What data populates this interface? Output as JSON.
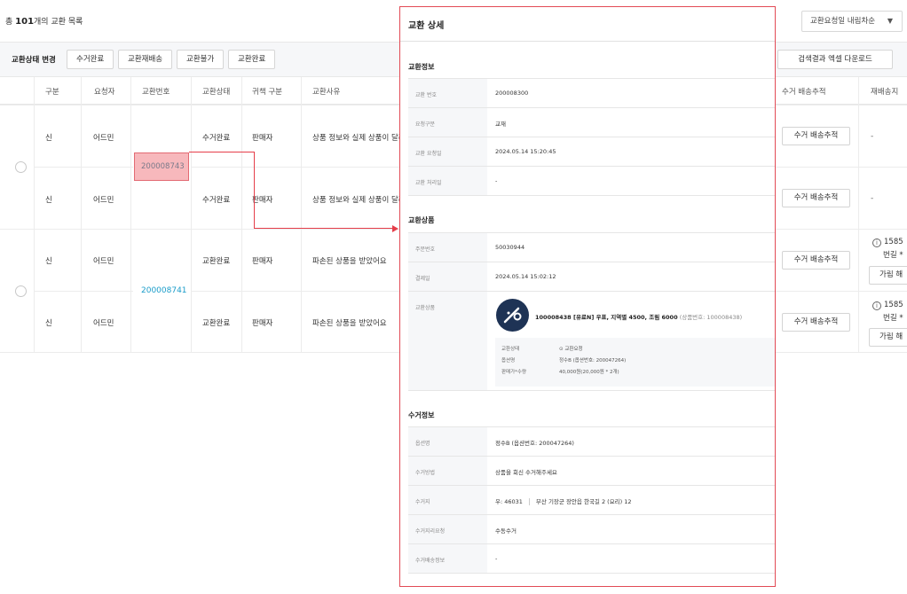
{
  "list": {
    "total_prefix": "총 ",
    "total_count": "101",
    "total_suffix": "개의 교환 목록",
    "sort_label": "교환요청일 내림차순",
    "toolbar": {
      "label": "교환상태 변경",
      "buttons": [
        "수거완료",
        "교환재배송",
        "교환불가",
        "교환완료"
      ],
      "excel_label": "검색결과 엑셀 다운로드"
    },
    "headers": [
      "구분",
      "요청자",
      "교환번호",
      "교환상태",
      "귀책 구분",
      "교환사유",
      "수거 배송추적",
      "재배송지"
    ],
    "rows": [
      {
        "type": "신",
        "requester": "어드민",
        "status": "수거완료",
        "fault": "판매자",
        "reason": "상품 정보와 실제 상품이 달라"
      },
      {
        "type": "신",
        "requester": "어드민",
        "status": "수거완료",
        "fault": "판매자",
        "reason": "상품 정보와 실제 상품이 달라"
      },
      {
        "type": "신",
        "requester": "어드민",
        "status": "교환완료",
        "fault": "판매자",
        "reason": "파손된 상품을 받았어요"
      },
      {
        "type": "신",
        "requester": "어드민",
        "status": "교환완료",
        "fault": "판매자",
        "reason": "파손된 상품을 받았어요"
      }
    ],
    "group_numbers": [
      "200008743",
      "200008741"
    ],
    "track_label": "수거 배송추적",
    "dash": "-",
    "reship_number": "1585",
    "reship_sub": "번길 *",
    "hide_label": "가림 해",
    "info_icon": "i"
  },
  "detail": {
    "title": "교환 상세",
    "info_title": "교환정보",
    "info_rows": [
      {
        "k": "교환 번호",
        "v": "200008300"
      },
      {
        "k": "요청구분",
        "v": "교재"
      },
      {
        "k": "교환 요청일",
        "v": "2024.05.14 15:20:45"
      },
      {
        "k": "교환 처리일",
        "v": "-"
      }
    ],
    "product_title": "교환상품",
    "product_rows": [
      {
        "k": "주문번호",
        "v": "50030944"
      },
      {
        "k": "결제일",
        "v": "2024.05.14 15:02:12"
      }
    ],
    "product_key": "교환상품",
    "product_name": "100008438 [유료N] 우표, 지역별 4500, 조림 6000",
    "product_sub": "(상품번호: 100008438)",
    "product_detail": [
      {
        "k": "교환상태",
        "v": "⊙ 교환요청"
      },
      {
        "k": "옵션명",
        "v": "정수B (옵션번호: 200047264)"
      },
      {
        "k": "판매가*수량",
        "v": "40,000원(20,000원 * 2개)"
      }
    ],
    "pickup_title": "수거정보",
    "pickup_rows": [
      {
        "k": "옵션명",
        "v": "정수B (옵션번호: 200047264)"
      },
      {
        "k": "수거방법",
        "v": "상품을 회신 수거해주세요"
      },
      {
        "k": "수거지",
        "v": "우: 46031"
      },
      {
        "k": "수거지리요청",
        "v": "수동수거"
      },
      {
        "k": "수거배송정보",
        "v": "-"
      }
    ],
    "pickup_address": "부산 기장군 장안읍 한국길 2 (요리) 12"
  }
}
